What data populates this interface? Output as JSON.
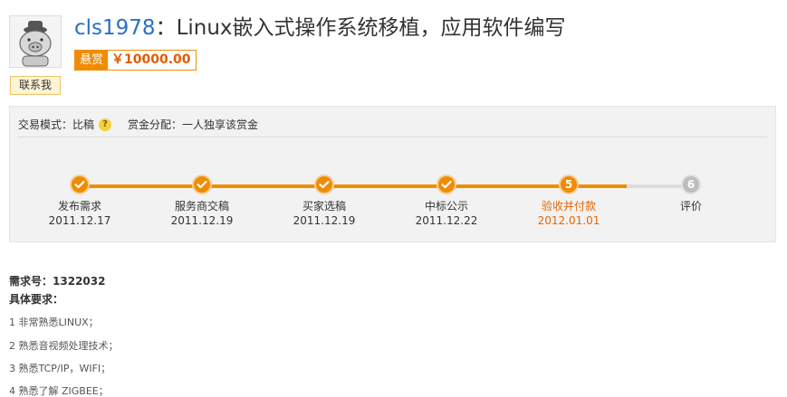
{
  "header": {
    "username": "cls1978",
    "separator": "：",
    "title": "Linux嵌入式操作系统移植，应用软件编写",
    "bounty_tag": "悬赏",
    "bounty_amount": "￥10000.00",
    "contact_label": "联系我"
  },
  "trade": {
    "mode_label": "交易模式：",
    "mode_value": "比稿",
    "mode_help_icon": "question-icon",
    "split_label": "赏金分配：",
    "split_value": "一人独享该赏金"
  },
  "steps": [
    {
      "number": "1",
      "label": "发布需求",
      "date": "2011.12.17",
      "status": "done"
    },
    {
      "number": "2",
      "label": "服务商交稿",
      "date": "2011.12.19",
      "status": "done"
    },
    {
      "number": "3",
      "label": "买家选稿",
      "date": "2011.12.19",
      "status": "done"
    },
    {
      "number": "4",
      "label": "中标公示",
      "date": "2011.12.22",
      "status": "done"
    },
    {
      "number": "5",
      "label": "验收并付款",
      "date": "2012.01.01",
      "status": "current"
    },
    {
      "number": "6",
      "label": "评价",
      "date": "",
      "status": "todo"
    }
  ],
  "requirements": {
    "id_label": "需求号：",
    "id_value": "1322032",
    "title": "具体要求：",
    "items": [
      "1 非常熟悉LINUX；",
      "2 熟悉音视频处理技术；",
      "3 熟悉TCP/IP，WIFI；",
      "4 熟悉了解 ZIGBEE；"
    ]
  },
  "colors": {
    "accent": "#f08c00",
    "accent_text": "#e56600",
    "link": "#2a6fc9",
    "inactive": "#bdbdbd"
  }
}
